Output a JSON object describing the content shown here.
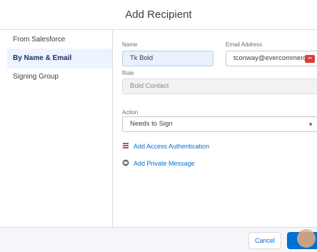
{
  "dialog": {
    "title": "Add Recipient"
  },
  "sidebar": {
    "items": [
      {
        "label": "From Salesforce",
        "active": false
      },
      {
        "label": "By Name & Email",
        "active": true
      },
      {
        "label": "Signing Group",
        "active": false
      }
    ]
  },
  "form": {
    "name_label": "Name",
    "name_value": "Tk Bold",
    "email_label": "Email Address",
    "email_value": "tconway@evercommerce",
    "role_label": "Role",
    "role_value": "Bold Contact",
    "action_label": "Action",
    "action_value": "Needs to Sign",
    "add_auth_label": "Add Access Authentication",
    "add_message_label": "Add Private Message"
  },
  "footer": {
    "cancel_label": "Cancel"
  },
  "colors": {
    "accent": "#0070d2",
    "active_bg": "#eef4ff"
  }
}
